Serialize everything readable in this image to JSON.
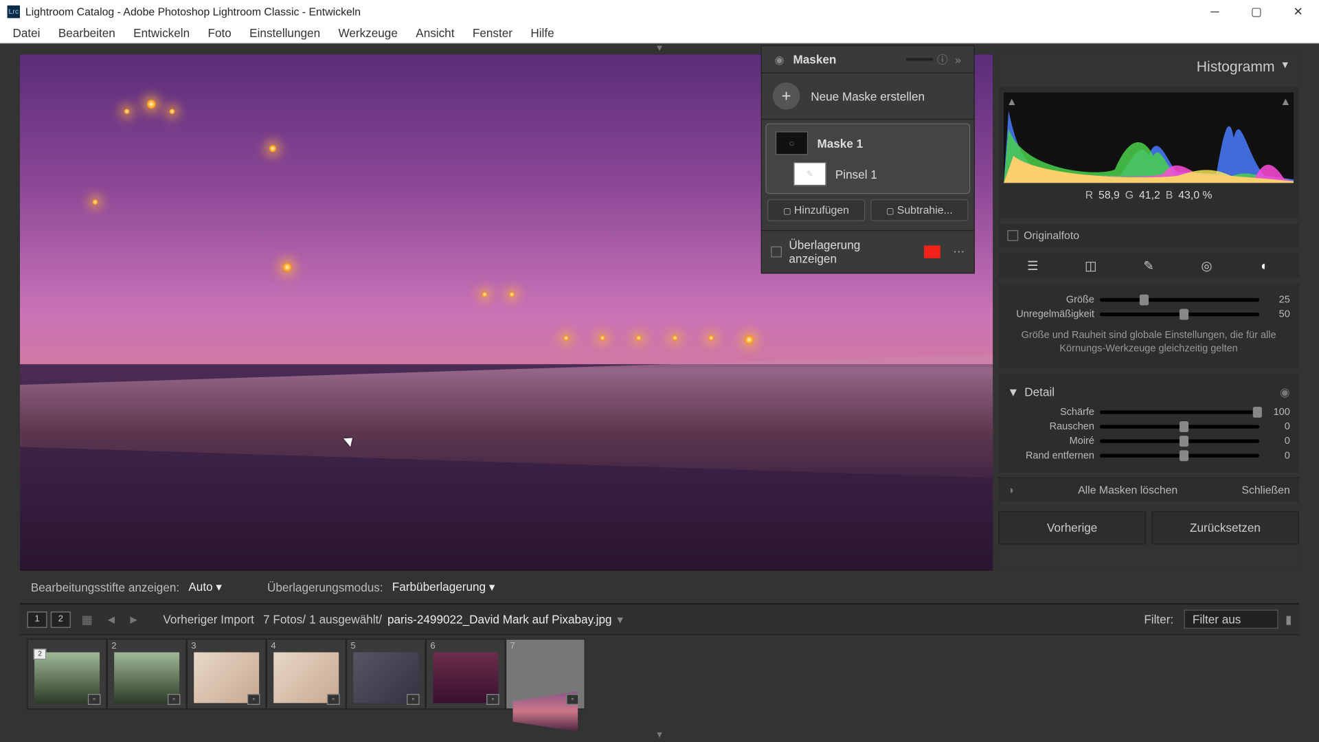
{
  "window": {
    "title": "Lightroom Catalog - Adobe Photoshop Lightroom Classic - Entwickeln",
    "app_abbr": "Lrc"
  },
  "menu": [
    "Datei",
    "Bearbeiten",
    "Entwickeln",
    "Foto",
    "Einstellungen",
    "Werkzeuge",
    "Ansicht",
    "Fenster",
    "Hilfe"
  ],
  "masks": {
    "title": "Masken",
    "new_label": "Neue Maske erstellen",
    "mask_name": "Maske 1",
    "brush_name": "Pinsel 1",
    "add_btn": "Hinzufügen",
    "sub_btn": "Subtrahie...",
    "overlay_label": "Überlagerung anzeigen",
    "overlay_color": "#f2221a"
  },
  "histogram": {
    "title": "Histogramm",
    "r_label": "R",
    "r_val": "58,9",
    "g_label": "G",
    "g_val": "41,2",
    "b_label": "B",
    "b_val": "43,0 %",
    "original_label": "Originalfoto"
  },
  "grain": {
    "size_label": "Größe",
    "size_val": "25",
    "rough_label": "Unregelmäßigkeit",
    "rough_val": "50",
    "info": "Größe und Rauheit sind globale Einstellungen, die für alle Körnungs-Werkzeuge gleichzeitig gelten"
  },
  "detail": {
    "title": "Detail",
    "sharp_label": "Schärfe",
    "sharp_val": "100",
    "noise_label": "Rauschen",
    "noise_val": "0",
    "moire_label": "Moiré",
    "moire_val": "0",
    "defringe_label": "Rand entfernen",
    "defringe_val": "0"
  },
  "mask_footer": {
    "delete": "Alle Masken löschen",
    "close": "Schließen"
  },
  "buttons": {
    "prev": "Vorherige",
    "reset": "Zurücksetzen"
  },
  "toolbar": {
    "edit_pins": "Bearbeitungsstifte anzeigen:",
    "auto": "Auto",
    "overlay_mode": "Überlagerungsmodus:",
    "color_overlay": "Farbüberlagerung"
  },
  "filmstrip": {
    "source": "Vorheriger Import",
    "count": "7 Fotos/",
    "selected": "1 ausgewählt/",
    "filename": "paris-2499022_David Mark auf Pixabay.jpg",
    "filter_label": "Filter:",
    "filter_value": "Filter aus",
    "items": [
      {
        "idx": "",
        "class": "first",
        "badge": "2"
      },
      {
        "idx": "2",
        "class": "first"
      },
      {
        "idx": "3",
        "class": "child"
      },
      {
        "idx": "4",
        "class": "child"
      },
      {
        "idx": "5",
        "class": "room"
      },
      {
        "idx": "6",
        "class": "city"
      },
      {
        "idx": "7",
        "class": "bridge",
        "sel": true
      }
    ]
  }
}
